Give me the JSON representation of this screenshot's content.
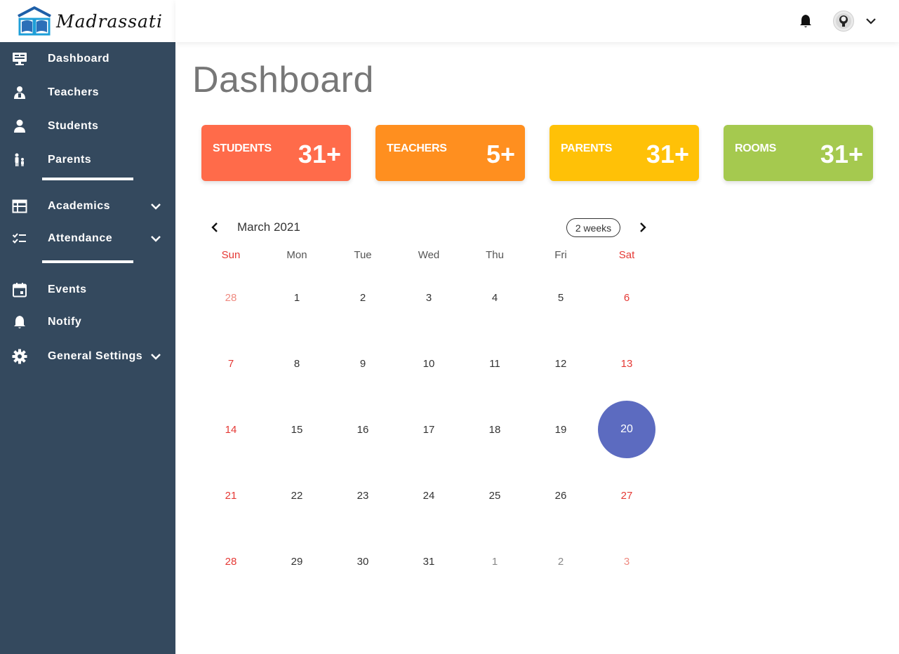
{
  "brand": {
    "name": "Madrassati"
  },
  "sidebar": {
    "group1": [
      {
        "label": "Dashboard",
        "icon": "monitor-icon"
      },
      {
        "label": "Teachers",
        "icon": "teacher-icon"
      },
      {
        "label": "Students",
        "icon": "student-icon"
      },
      {
        "label": "Parents",
        "icon": "parents-icon"
      }
    ],
    "group2": [
      {
        "label": "Academics",
        "icon": "table-icon"
      },
      {
        "label": "Attendance",
        "icon": "checklist-icon"
      }
    ],
    "group3": [
      {
        "label": "Events",
        "icon": "calendar-icon"
      },
      {
        "label": "Notify",
        "icon": "bell-icon"
      },
      {
        "label": "General Settings",
        "icon": "gear-icon"
      }
    ]
  },
  "header": {
    "icons": [
      "bell-icon",
      "avatar",
      "chevron-down-icon"
    ]
  },
  "page": {
    "title": "Dashboard"
  },
  "stats": [
    {
      "label": "STUDENTS",
      "value": "31+",
      "color": "#ff6b4a"
    },
    {
      "label": "TEACHERS",
      "value": "5+",
      "color": "#ff8f1f"
    },
    {
      "label": "PARENTS",
      "value": "31+",
      "color": "#ffc107"
    },
    {
      "label": "ROOMS",
      "value": "31+",
      "color": "#a5c94f"
    }
  ],
  "calendar": {
    "title": "March 2021",
    "view_label": "2 weeks",
    "weekdays": [
      "Sun",
      "Mon",
      "Tue",
      "Wed",
      "Thu",
      "Fri",
      "Sat"
    ],
    "weeks": [
      [
        "28",
        "1",
        "2",
        "3",
        "4",
        "5",
        "6"
      ],
      [
        "7",
        "8",
        "9",
        "10",
        "11",
        "12",
        "13"
      ],
      [
        "14",
        "15",
        "16",
        "17",
        "18",
        "19",
        "20"
      ],
      [
        "21",
        "22",
        "23",
        "24",
        "25",
        "26",
        "27"
      ],
      [
        "28",
        "29",
        "30",
        "31",
        "1",
        "2",
        "3"
      ]
    ],
    "today": "20",
    "accent_color": "#5c6bc0",
    "weekend_color": "#e53935"
  }
}
